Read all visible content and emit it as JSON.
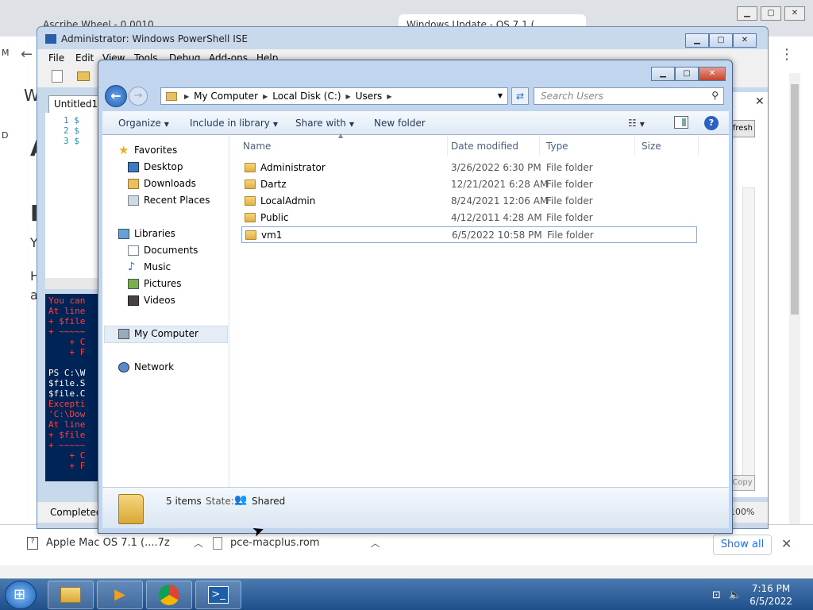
{
  "browser": {
    "tabs": [
      "Ascribe Wheel - 0 0010",
      "",
      "Windows Update - OS 7.1 (..."
    ],
    "page_left_letters": [
      "W",
      "A",
      "I",
      "Y",
      "H",
      "a"
    ],
    "left_marks": [
      "M",
      "D"
    ]
  },
  "ise": {
    "title": "Administrator: Windows PowerShell ISE",
    "menu": [
      "File",
      "Edit",
      "View",
      "Tools",
      "Debug",
      "Add-ons",
      "Help"
    ],
    "tab": "Untitled1.",
    "editor_lines": [
      "1   $",
      "2   $",
      "3   $"
    ],
    "console_lines": [
      {
        "t": "You can",
        "c": "#ff4040"
      },
      {
        "t": "At line",
        "c": "#ff4040"
      },
      {
        "t": "+ $file",
        "c": "#ff4040"
      },
      {
        "t": "+ ~~~~~",
        "c": "#ff4040"
      },
      {
        "t": "    + C",
        "c": "#ff4040"
      },
      {
        "t": "    + F",
        "c": "#ff4040"
      },
      {
        "t": "",
        "c": "#fff"
      },
      {
        "t": "PS C:\\W",
        "c": "#ffffff"
      },
      {
        "t": "$file.S",
        "c": "#ffffff"
      },
      {
        "t": "$file.C",
        "c": "#ffffff"
      },
      {
        "t": "Excepti",
        "c": "#ff4040"
      },
      {
        "t": "'C:\\Dow",
        "c": "#ff4040"
      },
      {
        "t": "At line",
        "c": "#ff4040"
      },
      {
        "t": "+ $file",
        "c": "#ff4040"
      },
      {
        "t": "+ ~~~~~",
        "c": "#ff4040"
      },
      {
        "t": "    + C",
        "c": "#ff4040"
      },
      {
        "t": "    + F",
        "c": "#ff4040"
      }
    ],
    "status": "Completed",
    "refresh_label": "fresh",
    "copy_label": "Copy",
    "zoom": "100%"
  },
  "explorer": {
    "breadcrumb": [
      "My Computer",
      "Local Disk (C:)",
      "Users"
    ],
    "search_placeholder": "Search Users",
    "toolbar": {
      "organize": "Organize",
      "include": "Include in library",
      "share": "Share with",
      "new_folder": "New folder"
    },
    "sidebar": {
      "favorites": "Favorites",
      "desktop": "Desktop",
      "downloads": "Downloads",
      "recent": "Recent Places",
      "libraries": "Libraries",
      "documents": "Documents",
      "music": "Music",
      "pictures": "Pictures",
      "videos": "Videos",
      "computer": "My Computer",
      "network": "Network"
    },
    "columns": [
      "Name",
      "Date modified",
      "Type",
      "Size"
    ],
    "files": [
      {
        "name": "Administrator",
        "date": "3/26/2022 6:30 PM",
        "type": "File folder"
      },
      {
        "name": "Dartz",
        "date": "12/21/2021 6:28 AM",
        "type": "File folder"
      },
      {
        "name": "LocalAdmin",
        "date": "8/24/2021 12:06 AM",
        "type": "File folder"
      },
      {
        "name": "Public",
        "date": "4/12/2011 4:28 AM",
        "type": "File folder"
      },
      {
        "name": "vm1",
        "date": "6/5/2022 10:58 PM",
        "type": "File folder"
      }
    ],
    "details": {
      "count": "5 items",
      "state_label": "State:",
      "state": "Shared"
    }
  },
  "downloads": {
    "items": [
      "Apple Mac OS 7.1 (....7z",
      "pce-macplus.rom"
    ],
    "show_all": "Show all"
  },
  "taskbar": {
    "time": "7:16 PM",
    "date": "6/5/2022"
  }
}
